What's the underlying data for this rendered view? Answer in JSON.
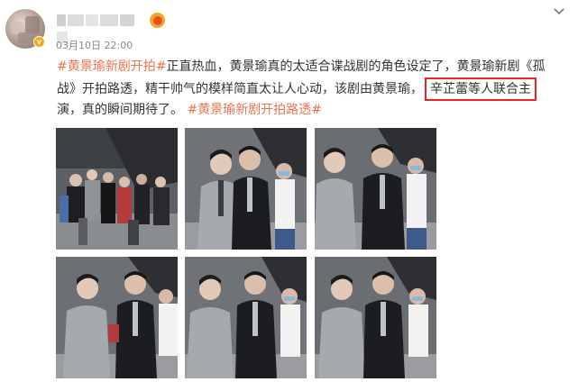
{
  "post": {
    "timestamp": "03月10日 22:00",
    "text": {
      "line1": {
        "hashtag": "#黄景瑜新剧开拍#",
        "text": "正直热血，黄景瑜真的太适合谍战剧的角色设定了，黄景瑜新剧《孤"
      },
      "line2": {
        "text": "战》开拍路透，精干帅气的模样简直太让人心动，该剧由黄景瑜，",
        "highlight": "辛芷蕾等人联合主"
      },
      "line3": {
        "text": "演，真的瞬间期待了。",
        "hashtag": "#黄景瑜新剧开拍路透#"
      }
    },
    "images": [
      {
        "alt": "crowd-scene-photo"
      },
      {
        "alt": "actor-gray-suit-photo"
      },
      {
        "alt": "actor-gray-suit-photo"
      },
      {
        "alt": "actor-gray-suit-photo"
      },
      {
        "alt": "actor-gray-suit-photo"
      },
      {
        "alt": "actor-gray-suit-photo"
      }
    ]
  },
  "colors": {
    "hashtag": "#eb7350",
    "highlight_border": "#e22",
    "timestamp": "#888888",
    "verify_badge": "#f8a61a"
  },
  "icons": {
    "more": "chevron-down-icon",
    "vip": "vip-badge-icon",
    "verified": "verified-badge-icon"
  }
}
